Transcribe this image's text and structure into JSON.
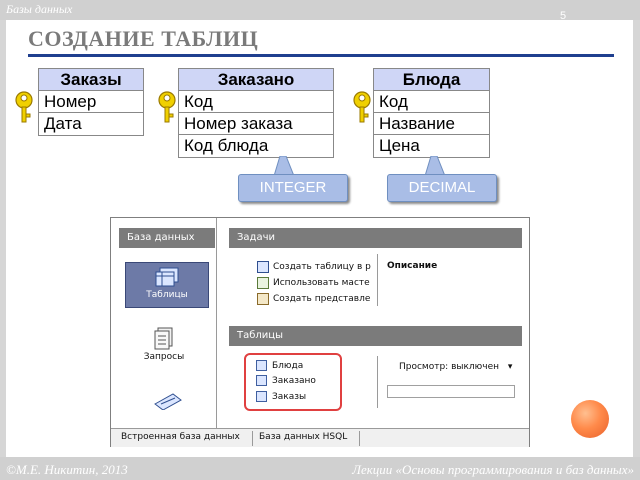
{
  "header": {
    "section_label": "Базы данных",
    "slide_number": "5"
  },
  "title": "СОЗДАНИЕ ТАБЛИЦ",
  "entities": [
    {
      "name": "Заказы",
      "fields": [
        "Номер",
        "Дата"
      ]
    },
    {
      "name": "Заказано",
      "fields": [
        "Код",
        "Номер заказа",
        "Код блюда"
      ]
    },
    {
      "name": "Блюда",
      "fields": [
        "Код",
        "Название",
        "Цена"
      ]
    }
  ],
  "callouts": {
    "integer": "INTEGER",
    "decimal": "DECIMAL"
  },
  "app": {
    "left_title": "База данных",
    "tasks_title": "Задачи",
    "left_items": {
      "tables": "Таблицы",
      "queries": "Запросы"
    },
    "tasks": [
      "Создать таблицу в р",
      "Использовать масте",
      "Создать представле"
    ],
    "description_label": "Описание",
    "tables_title": "Таблицы",
    "tables": [
      "Блюда",
      "Заказано",
      "Заказы"
    ],
    "view_label": "Просмотр: выключен",
    "footer_tabs": [
      "Встроенная база данных",
      "База данных HSQL"
    ]
  },
  "footer": {
    "left": "©М.Е. Никитин, 2013",
    "right": "Лекции «Основы программирования и баз данных»"
  },
  "colors": {
    "title_rule": "#1f3f8f",
    "table_header": "#cfd6f6",
    "callout": "#a9bde6",
    "panel_bar": "#7b7b7b",
    "selection": "#6d7aa7",
    "highlight_ring": "#e04040",
    "orb": "#ff8a4a"
  }
}
